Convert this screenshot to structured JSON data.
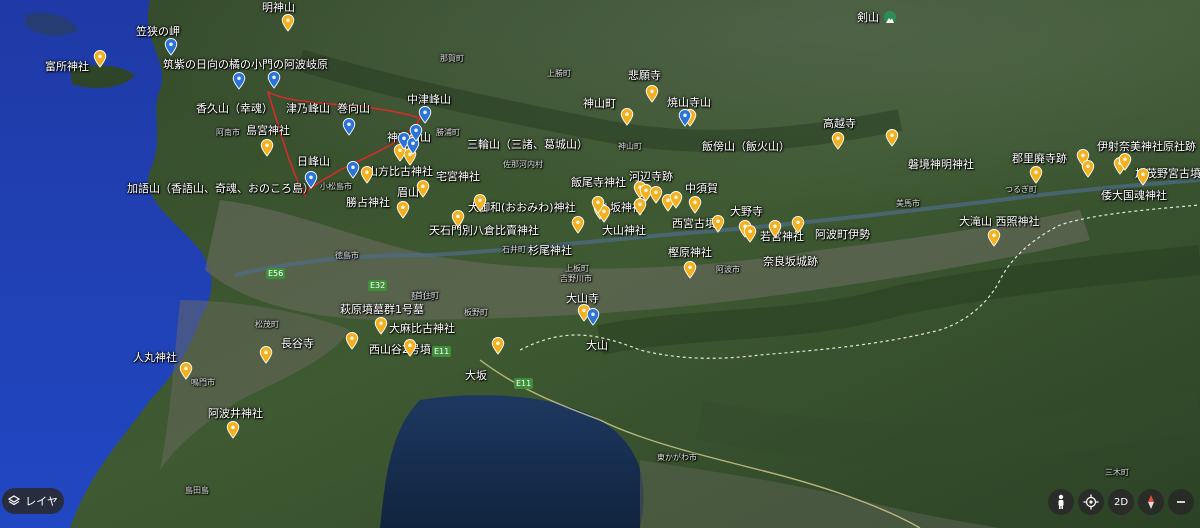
{
  "labels": {
    "l1": "明神山",
    "l2": "笠狭の岬",
    "l3": "筑紫の日向の橘の小門の阿波岐原",
    "l4": "富所神社",
    "l5": "香久山（幸魂）",
    "l6": "津乃峰山",
    "l7": "巻向山",
    "l8": "中津峰山",
    "l9": "阿南市",
    "l10": "島宮神社",
    "l11": "神奈備山",
    "l12": "勝浦町",
    "l13": "三輪山（三諸、葛城山）",
    "l14": "日峰山",
    "l15": "山方比古神社",
    "l16": "宅宮神社",
    "l17": "加語山（香語山、奇魂、おのころ島）",
    "l18": "眉山",
    "l19": "勝占神社",
    "l20": "大御和(おおみわ)神社",
    "l21": "天石門別八倉比賣神社",
    "l22": "杉尾神社",
    "l23": "石井町",
    "l24": "八坂神社",
    "l25": "大山神社",
    "l26": "西宮古墳",
    "l27": "大野寺",
    "l28": "若宮神社",
    "l29": "阿波町伊勢",
    "l30": "悲願寺",
    "l31": "神山町",
    "l32": "焼山寺山",
    "l33": "神山町",
    "l34": "飯傍山（飯火山）",
    "l35": "高越寺",
    "l36": "磐境神明神社",
    "l37": "郡里廃寺跡",
    "l38": "伊射奈美神社原社跡",
    "l39": "加茂野宮古墳",
    "l40": "倭大国魂神社",
    "l41": "大滝山 西照神社",
    "l42": "飯尾寺神社",
    "l43": "河辺寺跡",
    "l44": "中須賀",
    "l45": "樫原神社",
    "l46": "奈良坂城跡",
    "l47": "阿波市",
    "l48": "吉野川市",
    "l49": "大山寺",
    "l50": "大山",
    "l51": "大坂",
    "l52": "萩原墳墓群1号墓",
    "l53": "大麻比古神社",
    "l54": "長谷寺",
    "l55": "西山谷2号墳",
    "l56": "板野町",
    "l57": "松茂町",
    "l58": "人丸神社",
    "l59": "阿波井神社",
    "l60": "鳴門市",
    "l61": "島田島",
    "l62": "剣山",
    "l63": "上勝町",
    "l64": "佐那河内村",
    "l65": "那賀町",
    "l66": "つるぎ町",
    "l67": "美馬市",
    "l68": "徳島市",
    "l69": "上板町",
    "l70": "東かがわ市",
    "l71": "三木町",
    "l72": "藍住町",
    "l73": "小松島市",
    "l74": "首住町"
  },
  "roads": {
    "e56": "E56",
    "e32": "E32",
    "e11a": "E11",
    "e11b": "E11"
  },
  "ui": {
    "layers_label": "レイヤ",
    "mode_2d": "2D"
  },
  "colors": {
    "pin_yellow": "#f4b11f",
    "pin_blue": "#2a73d8",
    "route_red": "#e0282a"
  }
}
